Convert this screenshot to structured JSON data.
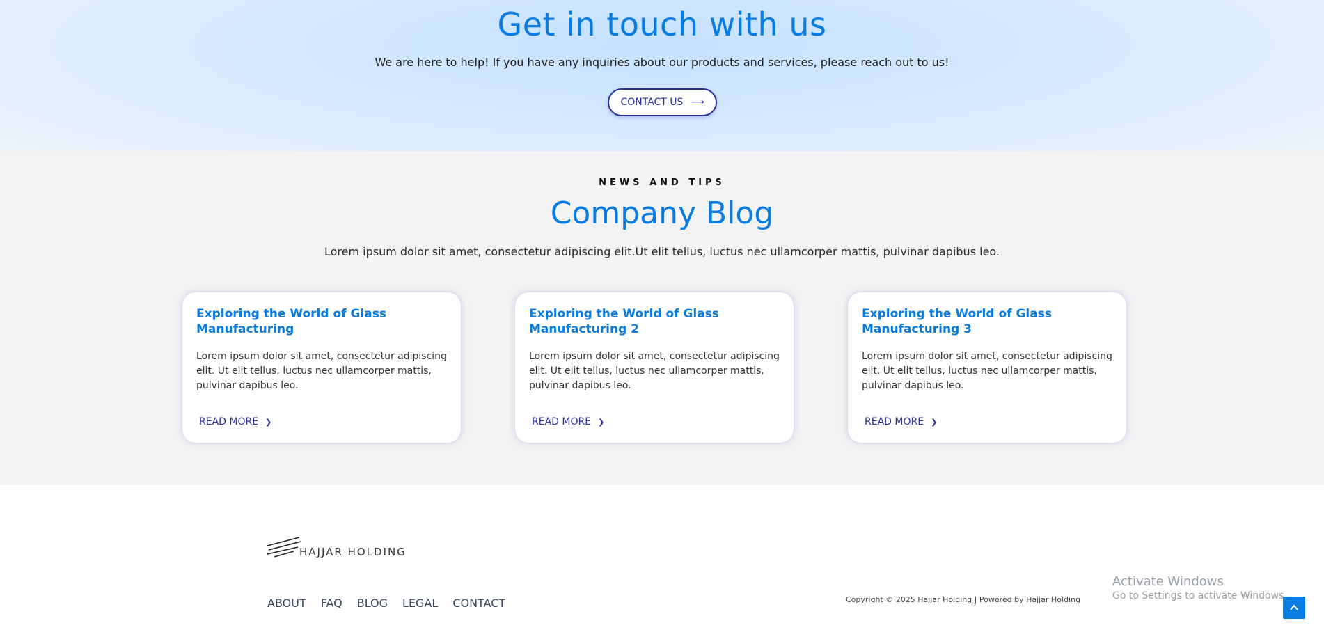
{
  "hero": {
    "title": "Get in touch with us",
    "subtitle": "We are here to help! If you have any inquiries about our products and services, please reach out to us!",
    "cta_label": "CONTACT US",
    "cta_arrow": "⟶"
  },
  "blog": {
    "eyebrow": "NEWS AND TIPS",
    "title": "Company Blog",
    "lead": "Lorem ipsum dolor sit amet, consectetur adipiscing elit.Ut elit tellus, luctus nec ullamcorper mattis, pulvinar dapibus leo.",
    "cards": [
      {
        "title": "Exploring the World of Glass Manufacturing",
        "excerpt": "Lorem ipsum dolor sit amet, consectetur adipiscing elit. Ut elit tellus, luctus nec ullamcorper mattis, pulvinar dapibus leo.",
        "read_more": "READ MORE",
        "chevron": "❯"
      },
      {
        "title": "Exploring the World of Glass Manufacturing 2",
        "excerpt": "Lorem ipsum dolor sit amet, consectetur adipiscing elit. Ut elit tellus, luctus nec ullamcorper mattis, pulvinar dapibus leo.",
        "read_more": "READ MORE",
        "chevron": "❯"
      },
      {
        "title": "Exploring the World of Glass Manufacturing 3",
        "excerpt": "Lorem ipsum dolor sit amet, consectetur adipiscing elit. Ut elit tellus, luctus nec ullamcorper mattis, pulvinar dapibus leo.",
        "read_more": "READ MORE",
        "chevron": "❯"
      }
    ]
  },
  "footer": {
    "logo_text": "HAJJAR HOLDING",
    "nav": [
      "ABOUT",
      "FAQ",
      "BLOG",
      "LEGAL",
      "CONTACT"
    ],
    "copyright": "Copyright © 2025 Hajjar Holding | Powered by Hajjar Holding"
  },
  "windows_watermark": {
    "title": "Activate Windows",
    "subtitle": "Go to Settings to activate Windows."
  },
  "icons": {
    "scroll_top": "chevron-up-icon",
    "logo_mark": "slash-lines-logo-icon"
  },
  "colors": {
    "accent_blue": "#0a7be0",
    "navy": "#2b2f9a",
    "blog_bg": "#f3f3f3"
  }
}
